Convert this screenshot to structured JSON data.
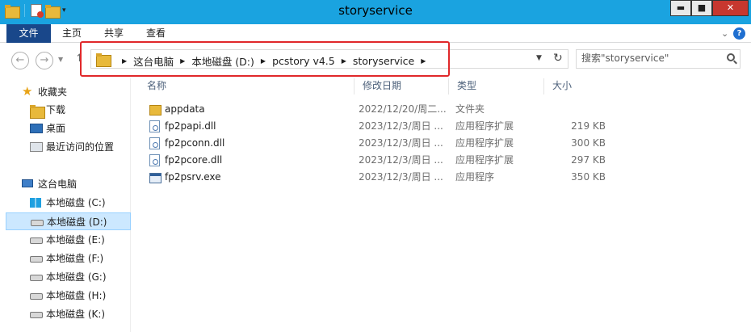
{
  "window": {
    "title": "storyservice",
    "controls": {
      "minimize": "▬",
      "maximize": "■",
      "close": "✕"
    }
  },
  "ribbon": {
    "tabs": {
      "file": "文件",
      "home": "主页",
      "share": "共享",
      "view": "查看"
    },
    "help": "?"
  },
  "navigation": {
    "breadcrumbs": [
      "这台电脑",
      "本地磁盘 (D:)",
      "pcstory v4.5",
      "storyservice"
    ],
    "search_placeholder": "搜索\"storyservice\""
  },
  "sidebar": {
    "favorites_label": "收藏夹",
    "favorites": [
      "下载",
      "桌面",
      "最近访问的位置"
    ],
    "this_pc_label": "这台电脑",
    "drives": [
      "本地磁盘 (C:)",
      "本地磁盘 (D:)",
      "本地磁盘 (E:)",
      "本地磁盘 (F:)",
      "本地磁盘 (G:)",
      "本地磁盘 (H:)",
      "本地磁盘 (K:)"
    ],
    "selected_drive": "本地磁盘 (D:)"
  },
  "file_list": {
    "columns": {
      "name": "名称",
      "date": "修改日期",
      "type": "类型",
      "size": "大小"
    },
    "rows": [
      {
        "icon": "folder-icon",
        "name": "appdata",
        "date": "2022/12/20/周二...",
        "type": "文件夹",
        "size": ""
      },
      {
        "icon": "dll-file-icon",
        "name": "fp2papi.dll",
        "date": "2023/12/3/周日 ...",
        "type": "应用程序扩展",
        "size": "219 KB"
      },
      {
        "icon": "dll-file-icon",
        "name": "fp2pconn.dll",
        "date": "2023/12/3/周日 ...",
        "type": "应用程序扩展",
        "size": "300 KB"
      },
      {
        "icon": "dll-file-icon",
        "name": "fp2pcore.dll",
        "date": "2023/12/3/周日 ...",
        "type": "应用程序扩展",
        "size": "297 KB"
      },
      {
        "icon": "exe-file-icon",
        "name": "fp2psrv.exe",
        "date": "2023/12/3/周日 ...",
        "type": "应用程序",
        "size": "350 KB"
      }
    ]
  },
  "colors": {
    "titlebar": "#1aa3e0",
    "file_tab": "#19478a",
    "close_button": "#c7372f",
    "highlight_box": "#e0282a",
    "selected_item": "#cce8ff"
  }
}
